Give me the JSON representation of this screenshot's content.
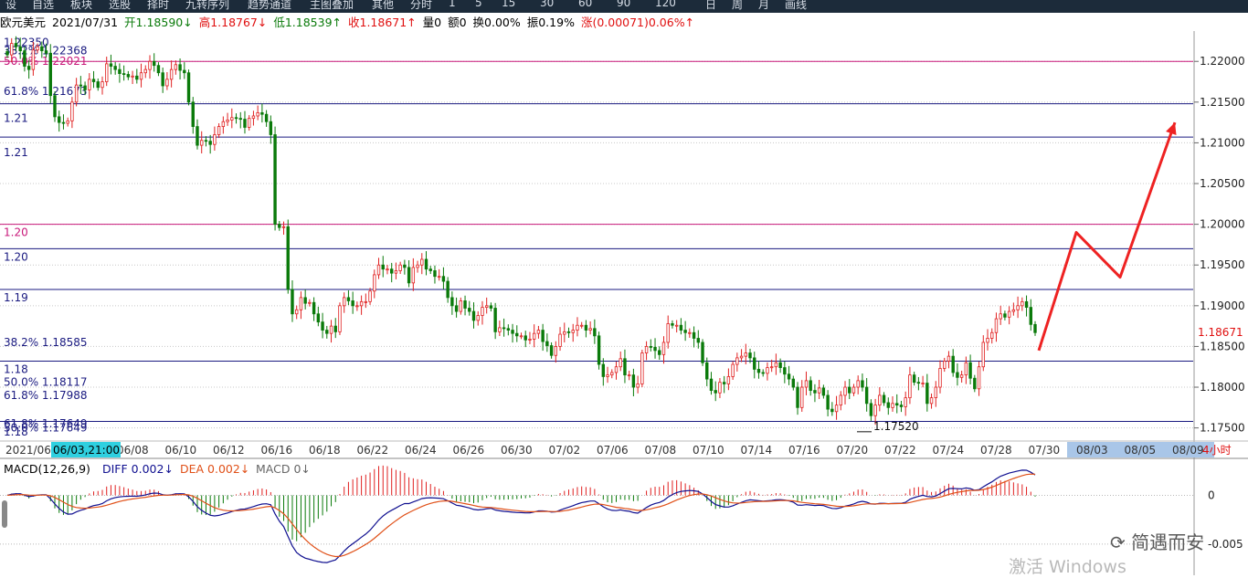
{
  "toolbar": {
    "items": [
      "设",
      "自选",
      "板块",
      "选股",
      "择时",
      "九转序列",
      "趋势通道",
      "主图叠加",
      "其他",
      "分时",
      "1",
      "5",
      "15",
      "30",
      "60",
      "90",
      "120",
      "日",
      "周",
      "月",
      "画线"
    ]
  },
  "info": {
    "name": "欧元美元",
    "date": "2021/07/31",
    "open": "开1.18590↓",
    "high": "高1.18767↓",
    "low": "低1.18539↑",
    "close": "收1.18671↑",
    "volume": "量0",
    "amount": "额0",
    "turnover": "换0.00%",
    "amplitude": "振0.19%",
    "change": "涨(0.00071)0.06%↑"
  },
  "colors": {
    "up": "#e02020",
    "down": "#0a7a0a",
    "line_pink": "#c8187a",
    "line_navy": "#1a1a80",
    "diff": "#101090",
    "dea": "#e05018",
    "axis_text": "#222222",
    "price_tag": "#e01010",
    "arrow": "#ee2222"
  },
  "chart_data": {
    "type": "candlestick",
    "timeframe": "4小时",
    "selected_date": "06/03,21:00",
    "ylim": [
      1.1735,
      1.2235
    ],
    "price_ticks": [
      "1.22000",
      "1.21500",
      "1.21000",
      "1.20500",
      "1.20000",
      "1.19500",
      "1.19000",
      "1.18500",
      "1.18000",
      "1.17500"
    ],
    "last_price": "1.18671",
    "date_labels": [
      "2021/06",
      "06/08",
      "06/10",
      "06/12",
      "06/16",
      "06/18",
      "06/22",
      "06/24",
      "06/26",
      "06/30",
      "07/02",
      "07/06",
      "07/08",
      "07/10",
      "07/14",
      "07/16",
      "07/20",
      "07/22",
      "07/24",
      "07/28",
      "07/30",
      "08/03",
      "08/05",
      "08/09"
    ],
    "low_marker": "1.17520",
    "horizontal_lines": [
      {
        "price": 1.22,
        "color": "#c8187a",
        "label": "50.0% 1.22021",
        "label_price": 1.22
      },
      {
        "price": 1.2148,
        "color": "#1a1a80",
        "label": "61.8% 1.21673",
        "label_price": 1.2163
      },
      {
        "price": 1.2107,
        "color": "#1a1a80",
        "label": "1.21",
        "label_price": 1.213
      },
      {
        "price": 1.2,
        "color": "#c8187a",
        "label": "1.20",
        "label_price": 1.199
      },
      {
        "price": 1.197,
        "color": "#1a1a80",
        "label": "1.20",
        "label_price": 1.196
      },
      {
        "price": 1.192,
        "color": "#1a1a80",
        "label": "1.19",
        "label_price": 1.191
      },
      {
        "price": 1.1832,
        "color": "#1a1a80",
        "label": "1.18",
        "label_price": 1.1822
      },
      {
        "price": 1.1758,
        "color": "#1a1a80",
        "label": "61.8% 1.17649",
        "label_price": 1.1755
      }
    ],
    "fib_labels": [
      {
        "label": "1.22350",
        "price": 1.2223
      },
      {
        "label": "38.2% 1.22368",
        "price": 1.2213
      },
      {
        "label": "1.21",
        "price": 1.2088
      },
      {
        "label": "38.2% 1.18585",
        "price": 1.1855
      },
      {
        "label": "50.0% 1.18117",
        "price": 1.1806
      },
      {
        "label": "61.8% 1.17988",
        "price": 1.179
      },
      {
        "label": "50.0% 1.17649",
        "price": 1.175
      },
      {
        "label": "1.18",
        "price": 1.1745
      }
    ],
    "closes": [
      1.2208,
      1.2222,
      1.2218,
      1.2213,
      1.2194,
      1.219,
      1.2214,
      1.2218,
      1.2213,
      1.221,
      1.2158,
      1.2132,
      1.2125,
      1.2124,
      1.2127,
      1.215,
      1.2171,
      1.217,
      1.2165,
      1.2178,
      1.2175,
      1.2168,
      1.2175,
      1.2197,
      1.2194,
      1.219,
      1.2185,
      1.2184,
      1.2181,
      1.2182,
      1.2178,
      1.2186,
      1.219,
      1.22,
      1.2195,
      1.2186,
      1.217,
      1.2178,
      1.219,
      1.2196,
      1.2189,
      1.2186,
      1.215,
      1.212,
      1.2097,
      1.2103,
      1.2102,
      1.2098,
      1.211,
      1.212,
      1.2126,
      1.2128,
      1.2131,
      1.213,
      1.2129,
      1.2119,
      1.213,
      1.2133,
      1.2137,
      1.2135,
      1.2126,
      1.211,
      1.2,
      1.1996,
      1.1997,
      1.192,
      1.189,
      1.1895,
      1.191,
      1.1903,
      1.1904,
      1.189,
      1.188,
      1.187,
      1.1866,
      1.1875,
      1.1868,
      1.19,
      1.191,
      1.1906,
      1.19,
      1.19,
      1.1905,
      1.1905,
      1.1918,
      1.1938,
      1.195,
      1.1945,
      1.1945,
      1.194,
      1.1943,
      1.195,
      1.1947,
      1.1928,
      1.1947,
      1.195,
      1.1957,
      1.1945,
      1.1943,
      1.1936,
      1.1936,
      1.193,
      1.191,
      1.19,
      1.1893,
      1.1906,
      1.1897,
      1.1893,
      1.1882,
      1.1888,
      1.1898,
      1.19,
      1.1897,
      1.1868,
      1.1873,
      1.1872,
      1.187,
      1.1866,
      1.1863,
      1.1863,
      1.1858,
      1.1859,
      1.1866,
      1.187,
      1.1856,
      1.1851,
      1.1839,
      1.185,
      1.1865,
      1.1868,
      1.1867,
      1.187,
      1.1876,
      1.1876,
      1.187,
      1.1872,
      1.1863,
      1.1828,
      1.1813,
      1.1815,
      1.1818,
      1.1825,
      1.1835,
      1.1815,
      1.1815,
      1.18,
      1.1804,
      1.1842,
      1.185,
      1.1849,
      1.1845,
      1.184,
      1.1855,
      1.1878,
      1.1876,
      1.1876,
      1.187,
      1.1867,
      1.1867,
      1.186,
      1.1855,
      1.183,
      1.181,
      1.1796,
      1.1793,
      1.1806,
      1.1804,
      1.1813,
      1.1828,
      1.1836,
      1.1838,
      1.1842,
      1.1836,
      1.1822,
      1.1818,
      1.1817,
      1.1824,
      1.1825,
      1.183,
      1.1824,
      1.1816,
      1.181,
      1.18,
      1.1775,
      1.18,
      1.1808,
      1.1796,
      1.1793,
      1.1799,
      1.179,
      1.1773,
      1.177,
      1.1778,
      1.179,
      1.18,
      1.1793,
      1.18,
      1.1808,
      1.18,
      1.178,
      1.1765,
      1.1778,
      1.179,
      1.1781,
      1.1775,
      1.178,
      1.1778,
      1.1776,
      1.1787,
      1.1815,
      1.1806,
      1.1805,
      1.1805,
      1.178,
      1.1787,
      1.18,
      1.1823,
      1.1832,
      1.1838,
      1.1818,
      1.1812,
      1.1815,
      1.183,
      1.1811,
      1.1798,
      1.1825,
      1.1855,
      1.186,
      1.1867,
      1.1884,
      1.189,
      1.1886,
      1.1893,
      1.1895,
      1.19,
      1.1905,
      1.1898,
      1.1877,
      1.1867
    ],
    "projection": [
      [
        1.1845,
        "07/30"
      ],
      [
        1.199,
        "08/02"
      ],
      [
        1.1935,
        "08/04"
      ],
      [
        1.2125,
        "08/07"
      ]
    ],
    "macd": {
      "label": "MACD(12,26,9)",
      "diff_label": "DIFF 0.002↓",
      "dea_label": "DEA 0.002↓",
      "macd_label": "MACD 0↓",
      "ylim": [
        -0.0082,
        0.0036
      ],
      "ticks": [
        "0",
        "-0.005"
      ]
    }
  },
  "watermark": {
    "brand": "简遇而安",
    "os": "激活 Windows"
  }
}
